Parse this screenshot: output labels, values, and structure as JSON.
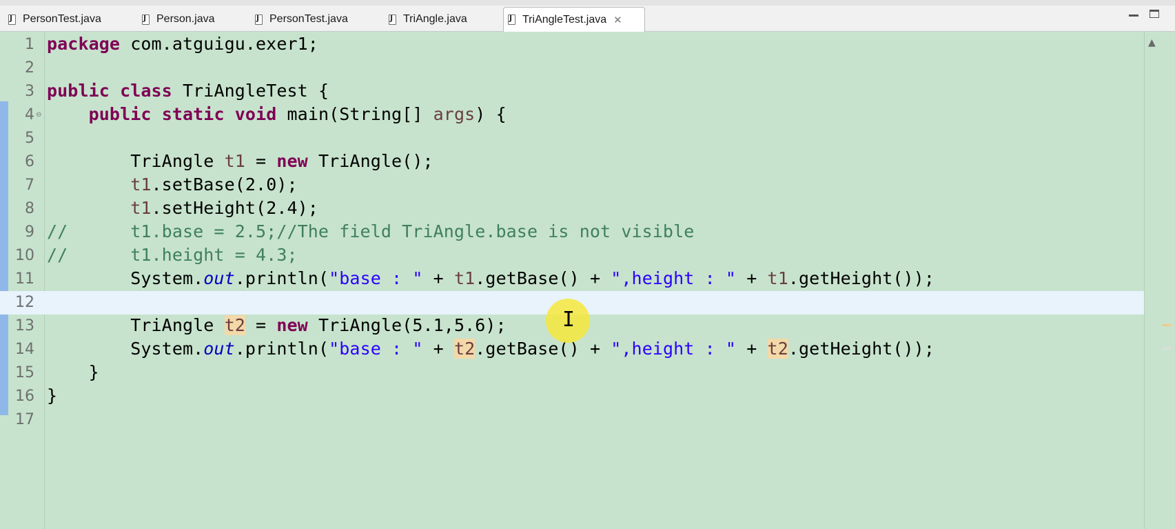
{
  "tabs": [
    {
      "label": "PersonTest.java",
      "active": false
    },
    {
      "label": "Person.java",
      "active": false
    },
    {
      "label": "PersonTest.java",
      "active": false
    },
    {
      "label": "TriAngle.java",
      "active": false
    },
    {
      "label": "TriAngleTest.java",
      "active": true
    }
  ],
  "icons": {
    "file": "java-file-icon",
    "close": "close-icon",
    "minimize": "minimize-icon",
    "maximize": "maximize-icon",
    "cursor": "text-cursor-icon"
  },
  "editor": {
    "lines": [
      {
        "n": "1",
        "text": "package com.atguigu.exer1;"
      },
      {
        "n": "2",
        "text": ""
      },
      {
        "n": "3",
        "text": "public class TriAngleTest {"
      },
      {
        "n": "4",
        "text": "    public static void main(String[] args) {"
      },
      {
        "n": "5",
        "text": ""
      },
      {
        "n": "6",
        "text": "        TriAngle t1 = new TriAngle();"
      },
      {
        "n": "7",
        "text": "        t1.setBase(2.0);"
      },
      {
        "n": "8",
        "text": "        t1.setHeight(2.4);"
      },
      {
        "n": "9",
        "text": "//      t1.base = 2.5;//The field TriAngle.base is not visible"
      },
      {
        "n": "10",
        "text": "//      t1.height = 4.3;"
      },
      {
        "n": "11",
        "text": "        System.out.println(\"base : \" + t1.getBase() + \",height : \" + t1.getHeight());"
      },
      {
        "n": "12",
        "text": ""
      },
      {
        "n": "13",
        "text": "        TriAngle t2 = new TriAngle(5.1,5.6);"
      },
      {
        "n": "14",
        "text": "        System.out.println(\"base : \" + t2.getBase() + \",height : \" + t2.getHeight());"
      },
      {
        "n": "15",
        "text": "    }"
      },
      {
        "n": "16",
        "text": "}"
      },
      {
        "n": "17",
        "text": ""
      }
    ],
    "current_line": "12"
  },
  "colors": {
    "background": "#c7e3cd",
    "keyword": "#7f0055",
    "string": "#2a00ff",
    "comment": "#3f7f5f",
    "field": "#0000c0",
    "occurrence": "#f3d9a9",
    "cursor_highlight": "#f6e83c"
  }
}
